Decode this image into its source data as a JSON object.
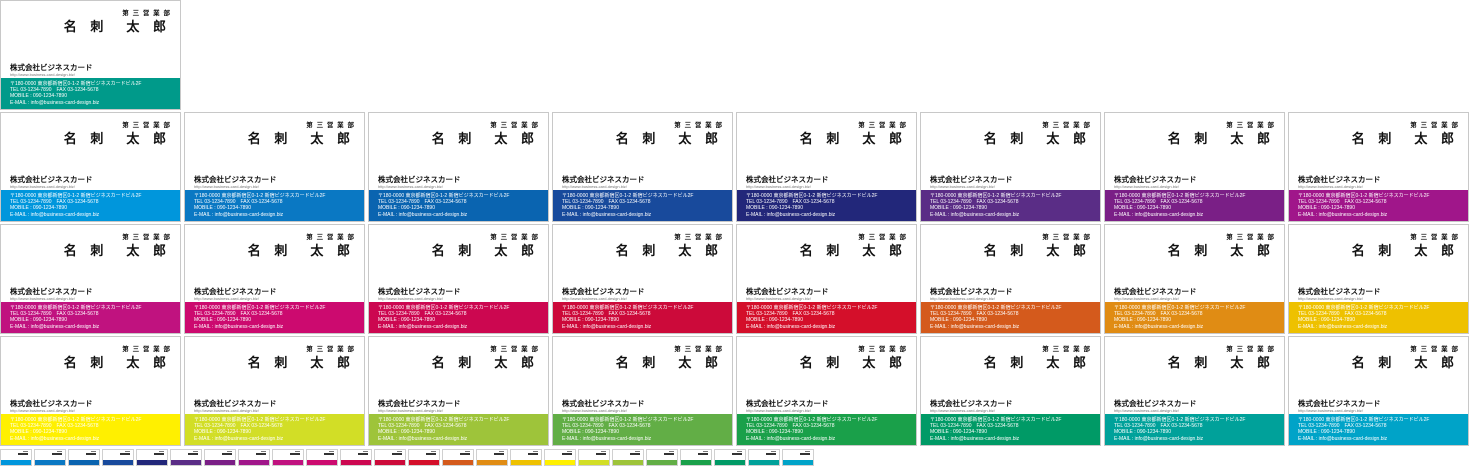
{
  "card_text": {
    "department": "第 三 営 業 部",
    "name": "名 刺　太 郎",
    "company": "株式会社ビジネスカード",
    "url": "http://www.business-card-design.biz/",
    "address": "〒180-0000 東京都新宿区0-1-2 新宿ビジネスカードビル2F",
    "tel_fax": "TEL 03-1234-7890　FAX 03-1234-5678",
    "mobile": "MOBILE : 090-1234-7890",
    "email": "E-MAIL : info@business-card-design.biz"
  },
  "cards": [
    {
      "color": "#009a8a"
    },
    {
      "color": "#0096dc"
    },
    {
      "color": "#0a78c3"
    },
    {
      "color": "#0a64b0"
    },
    {
      "color": "#184a9c"
    },
    {
      "color": "#22277a"
    },
    {
      "color": "#5a2d86"
    },
    {
      "color": "#7a1f86"
    },
    {
      "color": "#a0168a"
    },
    {
      "color": "#c0127f"
    },
    {
      "color": "#cc0a6f"
    },
    {
      "color": "#cc0750"
    },
    {
      "color": "#cc0a3a"
    },
    {
      "color": "#d40f2a"
    },
    {
      "color": "#d45a1c"
    },
    {
      "color": "#e08c14"
    },
    {
      "color": "#eec100"
    },
    {
      "color": "#fff000"
    },
    {
      "color": "#d2de26"
    },
    {
      "color": "#9ec43a"
    },
    {
      "color": "#62ae46"
    },
    {
      "color": "#1aa04a"
    },
    {
      "color": "#009a66"
    },
    {
      "color": "#00a19a"
    },
    {
      "color": "#00a3c8"
    }
  ],
  "thumbnails": [
    {
      "color": "#0096dc"
    },
    {
      "color": "#0a78c3"
    },
    {
      "color": "#0a64b0"
    },
    {
      "color": "#184a9c"
    },
    {
      "color": "#22277a"
    },
    {
      "color": "#5a2d86"
    },
    {
      "color": "#7a1f86"
    },
    {
      "color": "#a0168a"
    },
    {
      "color": "#c0127f"
    },
    {
      "color": "#cc0a6f"
    },
    {
      "color": "#cc0750"
    },
    {
      "color": "#cc0a3a"
    },
    {
      "color": "#d40f2a"
    },
    {
      "color": "#d45a1c"
    },
    {
      "color": "#e08c14"
    },
    {
      "color": "#eec100"
    },
    {
      "color": "#fff000"
    },
    {
      "color": "#d2de26"
    },
    {
      "color": "#9ec43a"
    },
    {
      "color": "#62ae46"
    },
    {
      "color": "#1aa04a"
    },
    {
      "color": "#009a66"
    },
    {
      "color": "#00a19a"
    },
    {
      "color": "#00a3c8"
    }
  ]
}
